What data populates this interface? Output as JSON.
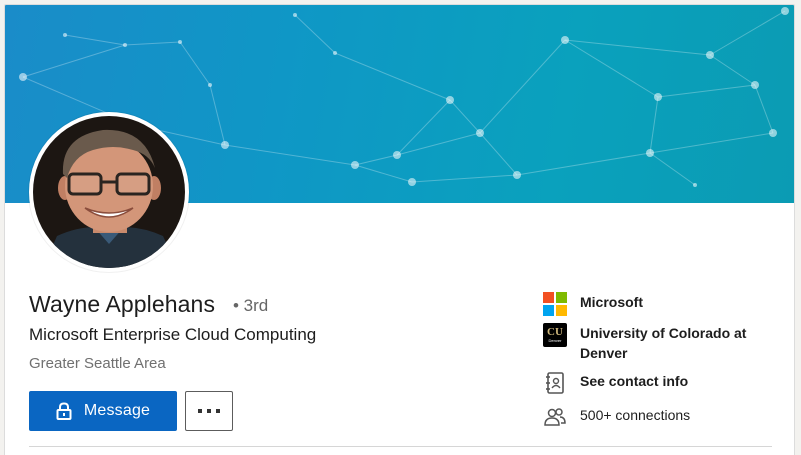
{
  "profile": {
    "name": "Wayne Applehans",
    "degree": "• 3rd",
    "headline": "Microsoft Enterprise Cloud Computing",
    "location": "Greater Seattle Area"
  },
  "actions": {
    "message_label": "Message",
    "message_icon": "lock-icon",
    "more_icon": "more-dots-icon"
  },
  "sidebar": {
    "company": {
      "label": "Microsoft",
      "icon": "microsoft-logo"
    },
    "school": {
      "label_line1": "University of Colorado at",
      "label_line2": "Denver",
      "logo_text": "CU",
      "logo_subtext": "Denver",
      "icon": "cu-denver-logo"
    },
    "contact": {
      "label": "See contact info",
      "icon": "address-book-icon"
    },
    "connections": {
      "label": "500+ connections",
      "icon": "people-icon"
    }
  },
  "colors": {
    "primary_button": "#0a66c2",
    "banner_start": "#1a8cc9",
    "banner_end": "#0b9bb3",
    "ms_red": "#f25022",
    "ms_green": "#7fba00",
    "ms_blue": "#00a4ef",
    "ms_yellow": "#ffb900"
  }
}
